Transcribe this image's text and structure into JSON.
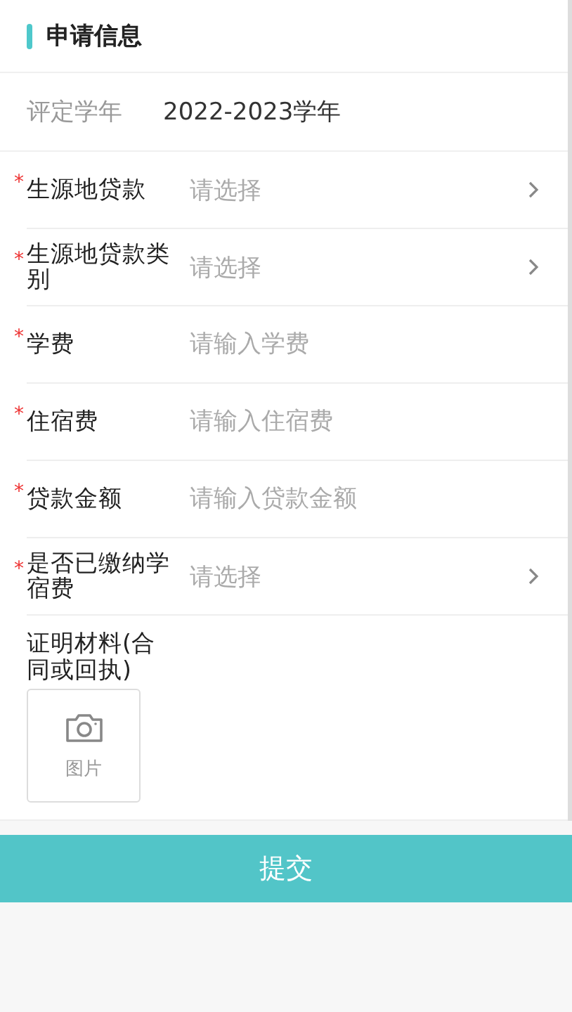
{
  "section_title": "申请信息",
  "year": {
    "label": "评定学年",
    "value": "2022-2023学年"
  },
  "fields": [
    {
      "kind": "select",
      "required": true,
      "label": "生源地贷款",
      "placeholder": "请选择"
    },
    {
      "kind": "select",
      "required": true,
      "label": "生源地贷款类别",
      "placeholder": "请选择"
    },
    {
      "kind": "input",
      "required": true,
      "label": "学费",
      "placeholder": "请输入学费"
    },
    {
      "kind": "input",
      "required": true,
      "label": "住宿费",
      "placeholder": "请输入住宿费"
    },
    {
      "kind": "input",
      "required": true,
      "label": "贷款金额",
      "placeholder": "请输入贷款金额"
    },
    {
      "kind": "select",
      "required": true,
      "label": "是否已缴纳学宿费",
      "placeholder": "请选择"
    }
  ],
  "required_mark": "*",
  "upload": {
    "label": "证明材料(合同或回执)",
    "button_label": "图片"
  },
  "submit": "提交"
}
